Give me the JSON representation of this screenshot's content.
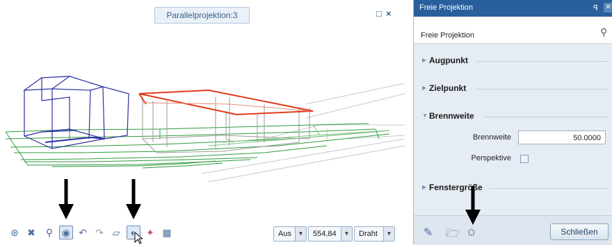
{
  "viewport": {
    "title": "Parallelprojektion:3",
    "window_controls": {
      "restore": "□",
      "close": "×"
    },
    "toolbar_icons": [
      "orbit-icon",
      "zoom-fit-icon",
      "zoom-icon",
      "free-projection-icon",
      "undo-view-icon",
      "redo-view-icon",
      "views-icon",
      "standard-views-icon",
      "render-icon",
      "screen-grid-icon"
    ],
    "status_selects": [
      {
        "value": "Aus"
      },
      {
        "value": "554,84"
      },
      {
        "value": "Draht"
      }
    ]
  },
  "panel": {
    "window_title": "Freie Projektion",
    "header_title": "Freie Projektion",
    "sections": {
      "augpunkt": "Augpunkt",
      "zielpunkt": "Zielpunkt",
      "brennweite": "Brennweite",
      "fenstergroesse": "Fenstergröße"
    },
    "fields": {
      "brennweite_label": "Brennweite",
      "brennweite_value": "50.0000",
      "perspektive_label": "Perspektive",
      "perspektive_checked": false
    },
    "bottom_icons": [
      "eyedropper-icon",
      "open-folder-icon",
      "save-favorite-icon"
    ],
    "close_label": "Schließen"
  },
  "colors": {
    "accent": "#2a5f9e",
    "house": "#2b2fa6",
    "highlight": "#e23a1a",
    "ground": "#2f9a3a"
  }
}
